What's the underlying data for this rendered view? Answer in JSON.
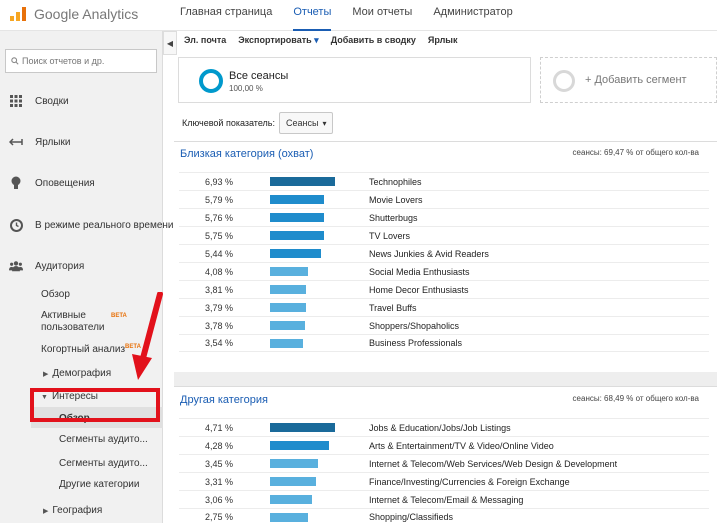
{
  "header": {
    "logo_text": "Google Analytics",
    "nav": [
      "Главная страница",
      "Отчеты",
      "Мои отчеты",
      "Администратор"
    ],
    "active_nav": 1
  },
  "sidebar": {
    "search_placeholder": "Поиск отчетов и др.",
    "items": [
      {
        "label": "Сводки",
        "icon": "grid-icon"
      },
      {
        "label": "Ярлыки",
        "icon": "shortcut-arrow-icon"
      },
      {
        "label": "Оповещения",
        "icon": "lightbulb-icon"
      },
      {
        "label": "В режиме реального времени",
        "icon": "clock-icon"
      },
      {
        "label": "Аудитория",
        "icon": "people-icon"
      }
    ],
    "audience_sub": {
      "overview": "Обзор",
      "active_users": "Активные пользователи",
      "cohort": "Когортный анализ",
      "beta": "BETA",
      "demographics": "Демография",
      "interests": "Интересы",
      "interests_overview": "Обзор",
      "segments1": "Сегменты аудито...",
      "segments2": "Сегменты аудито...",
      "other": "Другие категории",
      "geo": "География"
    }
  },
  "toolbar": {
    "email": "Эл. почта",
    "export": "Экспортировать",
    "add_dashboard": "Добавить в сводку",
    "shortcut": "Ярлык"
  },
  "segment": {
    "title": "Все сеансы",
    "percent": "100,00 %",
    "add_label": "+ Добавить сегмент"
  },
  "metric": {
    "label": "Ключевой показатель:",
    "value": "Сеансы"
  },
  "panels": [
    {
      "title": "Близкая категория (охват)",
      "note": "сеансы: 69,47 % от общего кол-ва",
      "rows": [
        {
          "pct": "6,93 %",
          "value": 6.93,
          "category": "Technophiles"
        },
        {
          "pct": "5,79 %",
          "value": 5.79,
          "category": "Movie Lovers"
        },
        {
          "pct": "5,76 %",
          "value": 5.76,
          "category": "Shutterbugs"
        },
        {
          "pct": "5,75 %",
          "value": 5.75,
          "category": "TV Lovers"
        },
        {
          "pct": "5,44 %",
          "value": 5.44,
          "category": "News Junkies & Avid Readers"
        },
        {
          "pct": "4,08 %",
          "value": 4.08,
          "category": "Social Media Enthusiasts"
        },
        {
          "pct": "3,81 %",
          "value": 3.81,
          "category": "Home Decor Enthusiasts"
        },
        {
          "pct": "3,79 %",
          "value": 3.79,
          "category": "Travel Buffs"
        },
        {
          "pct": "3,78 %",
          "value": 3.78,
          "category": "Shoppers/Shopaholics"
        },
        {
          "pct": "3,54 %",
          "value": 3.54,
          "category": "Business Professionals"
        }
      ]
    },
    {
      "title": "Другая категория",
      "note": "сеансы: 68,49 % от общего кол-ва",
      "rows": [
        {
          "pct": "4,71 %",
          "value": 4.71,
          "category": "Jobs & Education/Jobs/Job Listings"
        },
        {
          "pct": "4,28 %",
          "value": 4.28,
          "category": "Arts & Entertainment/TV & Video/Online Video"
        },
        {
          "pct": "3,45 %",
          "value": 3.45,
          "category": "Internet & Telecom/Web Services/Web Design & Development"
        },
        {
          "pct": "3,31 %",
          "value": 3.31,
          "category": "Finance/Investing/Currencies & Foreign Exchange"
        },
        {
          "pct": "3,06 %",
          "value": 3.06,
          "category": "Internet & Telecom/Email & Messaging"
        },
        {
          "pct": "2,75 %",
          "value": 2.75,
          "category": "Shopping/Classifieds"
        }
      ]
    }
  ],
  "colors": {
    "bar_dark": "#1a6a9a",
    "bar_mid": "#1f8ccc",
    "bar_light": "#59b0de",
    "accent": "#1a5db3",
    "highlight": "#e2111b"
  }
}
